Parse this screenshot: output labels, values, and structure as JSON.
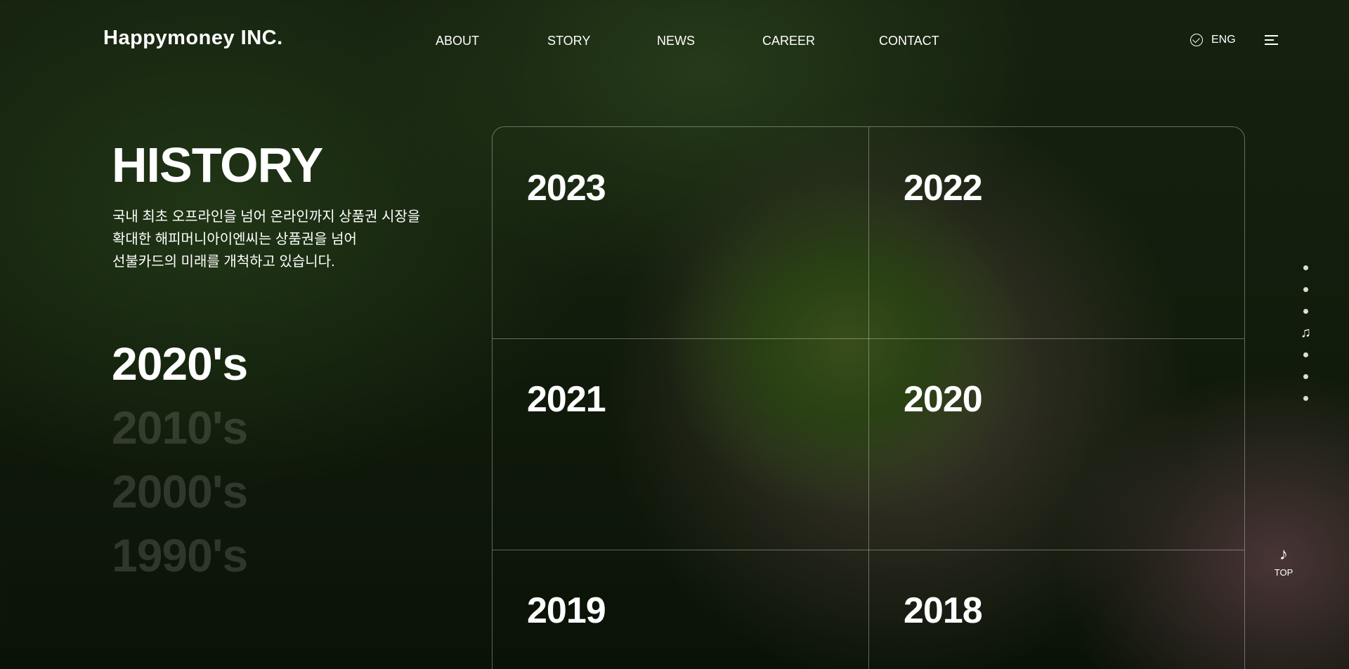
{
  "header": {
    "logo": "Happymoney INC.",
    "nav": [
      "ABOUT",
      "STORY",
      "NEWS",
      "CAREER",
      "CONTACT"
    ],
    "lang": "ENG"
  },
  "intro": {
    "title": "HISTORY",
    "desc_lines": [
      "국내 최초 오프라인을 넘어 온라인까지 상품권 시장을",
      "확대한 해피머니아이엔씨는 상품권을 넘어",
      "선불카드의 미래를 개척하고 있습니다."
    ]
  },
  "decades": {
    "items": [
      "2020's",
      "2010's",
      "2000's",
      "1990's"
    ],
    "active": "2020's"
  },
  "years": [
    "2023",
    "2022",
    "2021",
    "2020",
    "2019",
    "2018"
  ],
  "pager": {
    "top_label": "TOP"
  }
}
